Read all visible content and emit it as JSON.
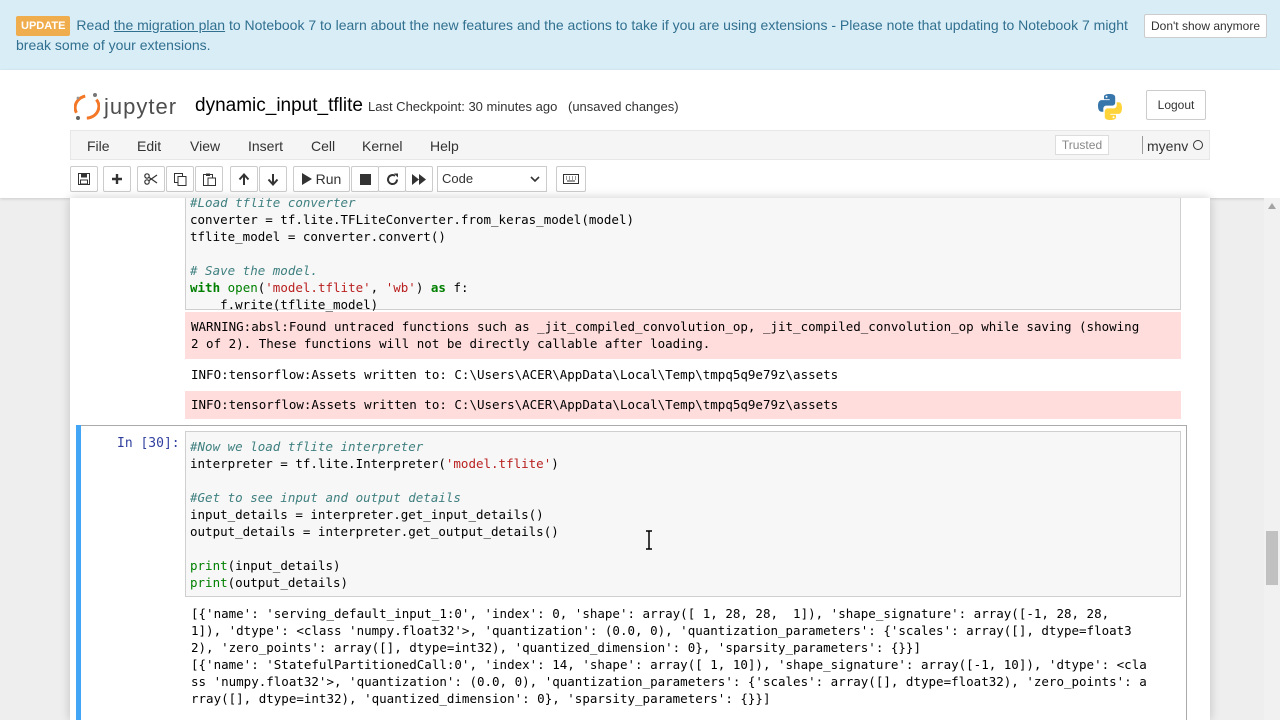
{
  "banner": {
    "badge": "UPDATE",
    "pre_link": "Read ",
    "link": "the migration plan",
    "post_link": " to Notebook 7 to learn about the new features and the actions to take if you are using extensions - Please note that updating to Notebook 7 might break some of your extensions.",
    "dismiss": "Don't show anymore"
  },
  "header": {
    "logo_text": "jupyter",
    "notebook_name": "dynamic_input_tflite",
    "checkpoint": "Last Checkpoint: 30 minutes ago",
    "unsaved": "(unsaved changes)",
    "logout": "Logout"
  },
  "menu": {
    "items": [
      "File",
      "Edit",
      "View",
      "Insert",
      "Cell",
      "Kernel",
      "Help"
    ],
    "trusted": "Trusted",
    "kernel_name": "myenv"
  },
  "toolbar": {
    "run_label": "Run",
    "cell_type": "Code",
    "icons": [
      "save-icon",
      "plus-icon",
      "cut-icon",
      "copy-icon",
      "paste-icon",
      "arrow-up-icon",
      "arrow-down-icon",
      "play-icon",
      "stop-icon",
      "restart-icon",
      "fast-forward-icon",
      "keyboard-icon"
    ]
  },
  "cell1": {
    "lines": [
      "#Load tflite converter",
      "converter = tf.lite.TFLiteConverter.from_keras_model(model)",
      "tflite_model = converter.convert()",
      "",
      "# Save the model.",
      "with open('model.tflite', 'wb') as f:",
      "    f.write(tflite_model)"
    ],
    "warning": [
      "WARNING:absl:Found untraced functions such as _jit_compiled_convolution_op, _jit_compiled_convolution_op while saving (showing",
      "2 of 2). These functions will not be directly callable after loading."
    ],
    "info_stdout": "INFO:tensorflow:Assets written to: C:\\Users\\ACER\\AppData\\Local\\Temp\\tmpq5q9e79z\\assets",
    "info_stderr": "INFO:tensorflow:Assets written to: C:\\Users\\ACER\\AppData\\Local\\Temp\\tmpq5q9e79z\\assets"
  },
  "cell2": {
    "prompt": "In [30]:",
    "code": {
      "c1": "#Now we load tflite interpreter",
      "l2a": "interpreter = tf.lite.Interpreter(",
      "l2s": "'model.tflite'",
      "l2b": ")",
      "c4": "#Get to see input and output details",
      "l5": "input_details = interpreter.get_input_details()",
      "l6": "output_details = interpreter.get_output_details()",
      "p8f": "print",
      "p8a": "(input_details)",
      "p9f": "print",
      "p9a": "(output_details)"
    },
    "output": [
      "[{'name': 'serving_default_input_1:0', 'index': 0, 'shape': array([ 1, 28, 28,  1]), 'shape_signature': array([-1, 28, 28,",
      "1]), 'dtype': <class 'numpy.float32'>, 'quantization': (0.0, 0), 'quantization_parameters': {'scales': array([], dtype=float3",
      "2), 'zero_points': array([], dtype=int32), 'quantized_dimension': 0}, 'sparsity_parameters': {}}]",
      "[{'name': 'StatefulPartitionedCall:0', 'index': 14, 'shape': array([ 1, 10]), 'shape_signature': array([-1, 10]), 'dtype': <cla",
      "ss 'numpy.float32'>, 'quantization': (0.0, 0), 'quantization_parameters': {'scales': array([], dtype=float32), 'zero_points': a",
      "rray([], dtype=int32), 'quantized_dimension': 0}, 'sparsity_parameters': {}}]"
    ]
  },
  "colors": {
    "banner_bg": "#d9edf7",
    "banner_text": "#31708f",
    "stderr_bg": "#ffdddd",
    "selected_bar": "#42a5f5",
    "prompt": "#303f9f"
  }
}
